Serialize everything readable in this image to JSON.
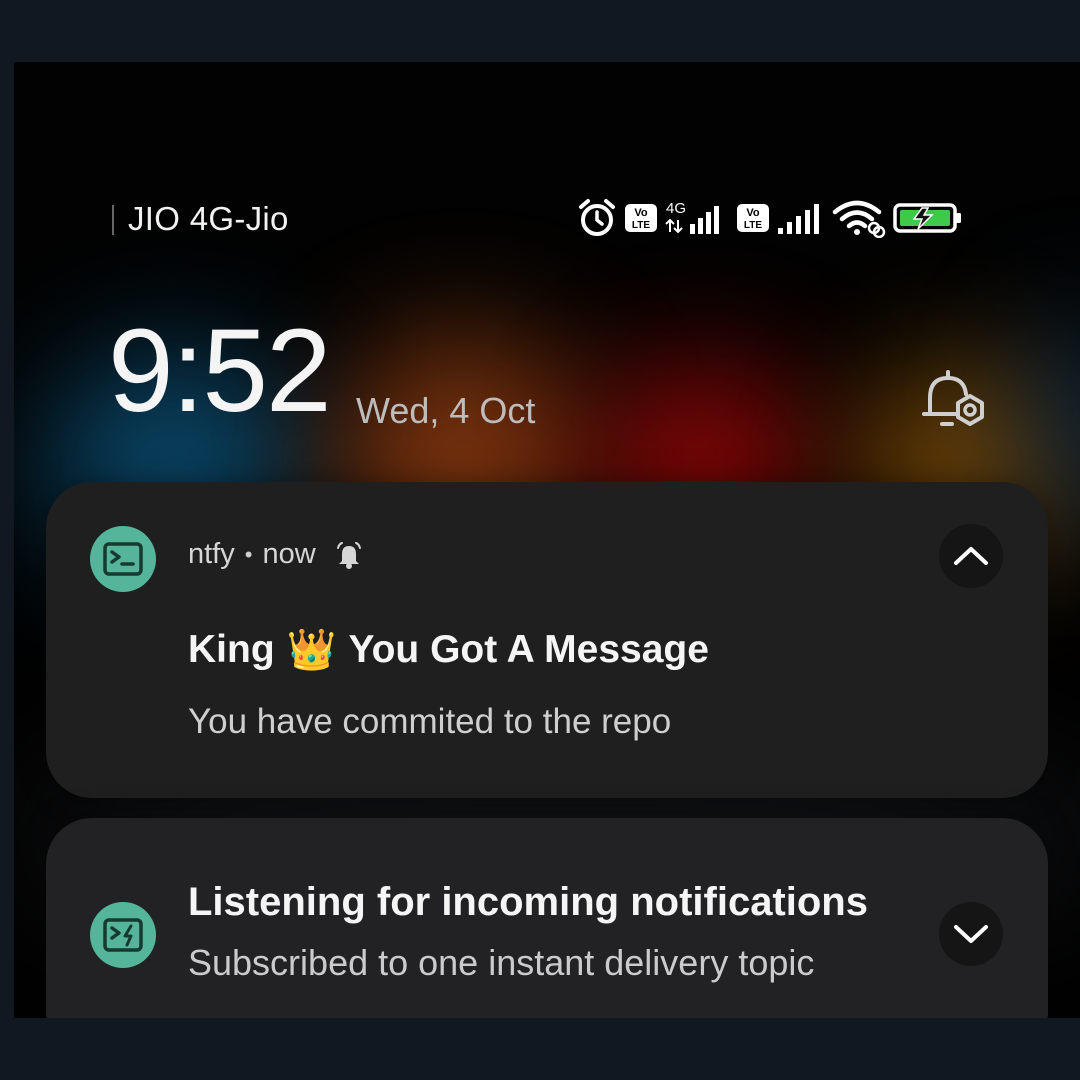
{
  "status_bar": {
    "carrier": "JIO 4G-Jio",
    "icons": [
      "alarm-icon",
      "volte-icon",
      "4g-signal-icon",
      "volte-icon",
      "signal-icon",
      "wifi-icon",
      "battery-charging-icon"
    ],
    "network_label": "4G",
    "volte_top": "Vo",
    "volte_bottom": "LTE"
  },
  "lockscreen": {
    "time": "9:52",
    "date": "Wed, 4 Oct"
  },
  "notifications": [
    {
      "app_name": "ntfy",
      "separator": "•",
      "time": "now",
      "title_prefix": "King",
      "title_emoji": "👑",
      "title_suffix": "You Got A Message",
      "body": "You have commited to the repo"
    },
    {
      "title": "Listening for incoming notifications",
      "body": "Subscribed to one instant delivery topic"
    }
  ],
  "colors": {
    "app_icon_bg": "#55b59a",
    "card_bg": "#1f1f20",
    "battery_fill": "#3ec94a"
  }
}
